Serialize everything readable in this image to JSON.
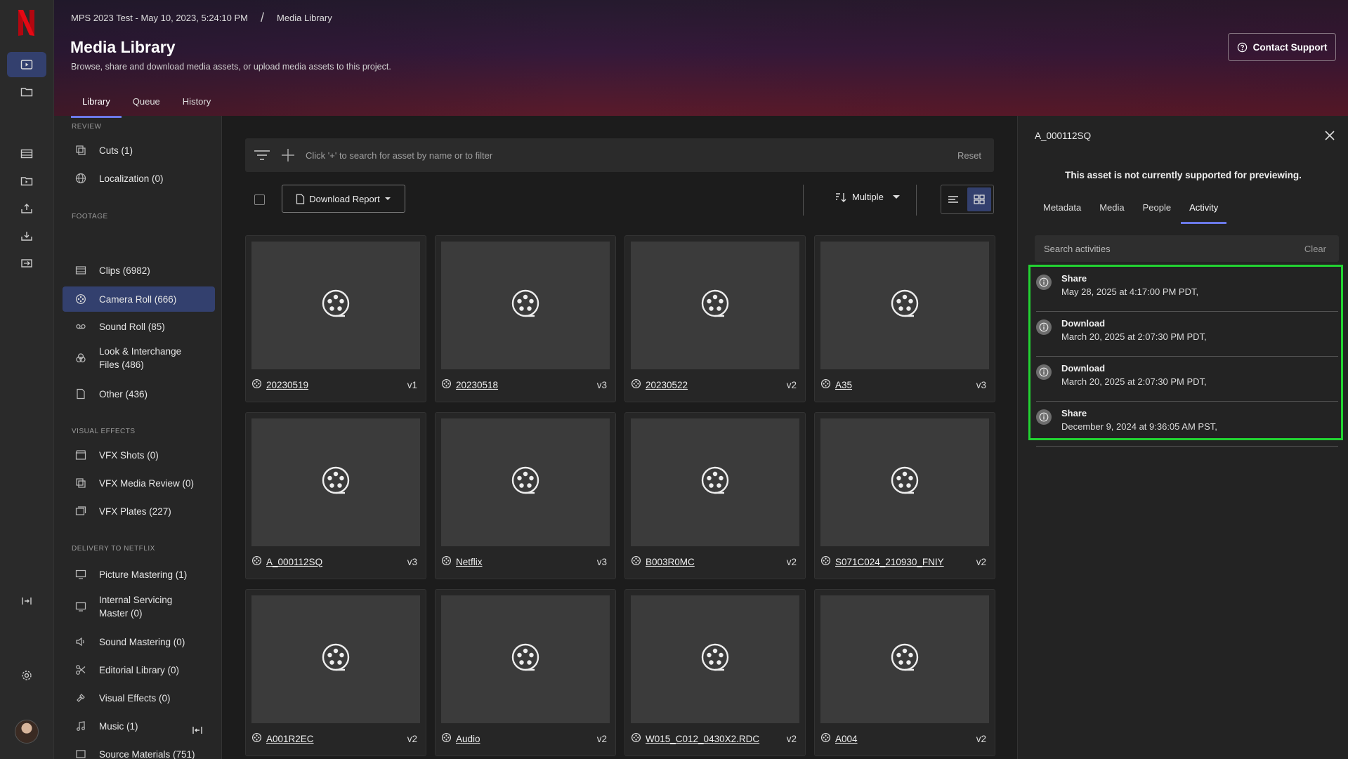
{
  "header": {
    "breadcrumb": [
      "MPS 2023 Test - May 10, 2023, 5:24:10 PM",
      "Media Library"
    ],
    "breadcrumb_sep": "/",
    "title": "Media Library",
    "subtitle": "Browse, share and download media assets, or upload media assets to this project.",
    "support_label": "Contact Support",
    "tabs": [
      {
        "label": "Library",
        "active": true
      },
      {
        "label": "Queue",
        "active": false
      },
      {
        "label": "History",
        "active": false
      }
    ]
  },
  "sidebar": {
    "sections": {
      "review": "REVIEW",
      "footage": "FOOTAGE",
      "vfx": "VISUAL EFFECTS",
      "delivery": "DELIVERY TO NETFLIX"
    },
    "items": [
      {
        "label": "Cuts (1)",
        "icon": "cuts-icon"
      },
      {
        "label": "Localization (0)",
        "icon": "globe-icon"
      },
      {
        "label": "Clips (6982)",
        "icon": "film-icon"
      },
      {
        "label": "Camera Roll (666)",
        "icon": "reel-icon",
        "active": true
      },
      {
        "label": "Sound Roll (85)",
        "icon": "tape-icon"
      },
      {
        "label": "Look & Interchange Files (486)",
        "icon": "palette-icon"
      },
      {
        "label": "Other (436)",
        "icon": "file-icon"
      },
      {
        "label": "VFX Shots (0)",
        "icon": "clapper-icon"
      },
      {
        "label": "VFX Media Review (0)",
        "icon": "review-icon"
      },
      {
        "label": "VFX Plates (227)",
        "icon": "plates-icon"
      },
      {
        "label": "Picture Mastering (1)",
        "icon": "monitor-icon"
      },
      {
        "label": "Internal Servicing Master (0)",
        "icon": "monitor-icon"
      },
      {
        "label": "Sound Mastering (0)",
        "icon": "speaker-icon"
      },
      {
        "label": "Editorial Library (0)",
        "icon": "scissors-icon"
      },
      {
        "label": "Visual Effects (0)",
        "icon": "vfx-icon"
      },
      {
        "label": "Music (1)",
        "icon": "music-icon"
      },
      {
        "label": "Source Materials (751)",
        "icon": "source-icon"
      }
    ]
  },
  "main": {
    "search_placeholder": "Click '+' to search for asset by name or to filter",
    "reset_label": "Reset",
    "download_report_label": "Download Report",
    "sort_label": "Multiple",
    "cards": [
      {
        "name": "20230519",
        "version": "v1"
      },
      {
        "name": "20230518",
        "version": "v3"
      },
      {
        "name": "20230522",
        "version": "v2"
      },
      {
        "name": "A35",
        "version": "v3"
      },
      {
        "name": "A_000112SQ",
        "version": "v3"
      },
      {
        "name": "Netflix",
        "version": "v3"
      },
      {
        "name": "B003R0MC",
        "version": "v2"
      },
      {
        "name": "S071C024_210930_FNIY",
        "version": "v2"
      },
      {
        "name": "A001R2EC",
        "version": "v2"
      },
      {
        "name": "Audio",
        "version": "v2"
      },
      {
        "name": "W015_C012_0430X2.RDC",
        "version": "v2"
      },
      {
        "name": "A004",
        "version": "v2"
      }
    ]
  },
  "panel": {
    "title": "A_000112SQ",
    "message": "This asset is not currently supported for previewing.",
    "tabs": [
      {
        "label": "Metadata",
        "active": false
      },
      {
        "label": "Media",
        "active": false
      },
      {
        "label": "People",
        "active": false
      },
      {
        "label": "Activity",
        "active": true
      }
    ],
    "search_placeholder": "Search activities",
    "clear_label": "Clear",
    "activities": [
      {
        "type": "Share",
        "date": "May 28, 2025 at 4:17:00 PM PDT,"
      },
      {
        "type": "Download",
        "date": "March 20, 2025 at 2:07:30 PM PDT,"
      },
      {
        "type": "Download",
        "date": "March 20, 2025 at 2:07:30 PM PDT,"
      },
      {
        "type": "Share",
        "date": "December 9, 2024 at 9:36:05 AM PST,"
      }
    ]
  },
  "colors": {
    "accent": "#6b79e8",
    "active_bg": "#33406e",
    "highlight": "#22d332",
    "netflix_red": "#e50914"
  }
}
